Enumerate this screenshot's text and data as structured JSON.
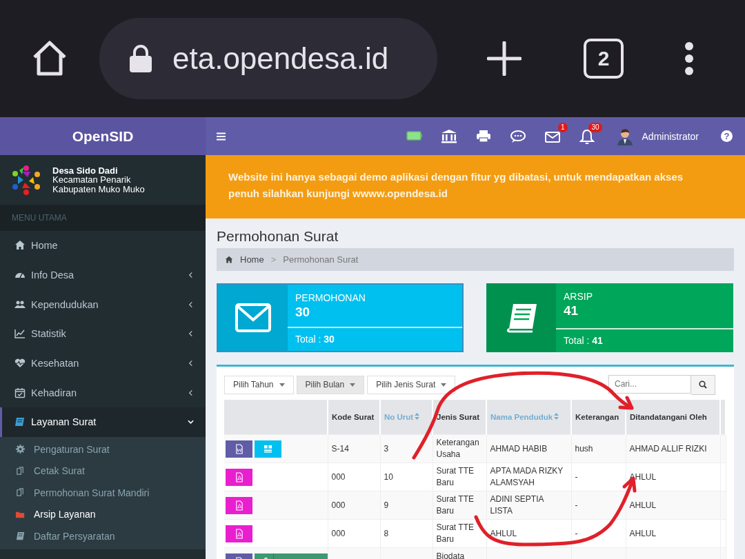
{
  "browser": {
    "url": "eta.opendesa.id",
    "tab_count": "2"
  },
  "header": {
    "brand": "OpenSID",
    "mail_badge": "1",
    "bell_badge": "30",
    "user": "Administrator",
    "help": "?"
  },
  "village": {
    "name": "Desa Sido Dadi",
    "district": "Kecamatan Penarik",
    "regency": "Kabupaten Muko Muko"
  },
  "menu_header": "MENU UTAMA",
  "menu": [
    {
      "label": "Home",
      "selected": false
    },
    {
      "label": "Info Desa",
      "expanded": false,
      "selected": false
    },
    {
      "label": "Kependudukan",
      "expanded": false,
      "selected": false
    },
    {
      "label": "Statistik",
      "expanded": false,
      "selected": false
    },
    {
      "label": "Kesehatan",
      "expanded": false,
      "selected": false
    },
    {
      "label": "Kehadiran",
      "expanded": false,
      "selected": false
    },
    {
      "label": "Layanan Surat",
      "expanded": true,
      "selected": true,
      "children": [
        {
          "label": "Pengaturan Surat",
          "selected": false
        },
        {
          "label": "Cetak Surat",
          "selected": false
        },
        {
          "label": "Permohonan Surat Mandiri",
          "selected": false
        },
        {
          "label": "Arsip Layanan",
          "selected": true
        },
        {
          "label": "Daftar Persyaratan",
          "selected": false
        }
      ]
    }
  ],
  "alert": "Website ini hanya sebagai demo aplikasi dengan fitur yg dibatasi, untuk mendapatkan akses penuh silahkan kunjungi wwww.opendesa.id",
  "page_title": "Permohonan Surat",
  "breadcrumb": {
    "items": [
      "Home",
      "Permohonan Surat"
    ],
    "separator": ">"
  },
  "cards": [
    {
      "label": "PERMOHONAN",
      "value": "30",
      "total": "Total : **30**",
      "color": "#00c0ef",
      "selected": true
    },
    {
      "label": "ARSIP",
      "value": "41",
      "total": "Total : **41**",
      "color": "#00a65a",
      "selected": false
    }
  ],
  "filters": [
    {
      "label": "Pilih Tahun",
      "focused": false
    },
    {
      "label": "Pilih Bulan",
      "focused": true
    },
    {
      "label": "Pilih Jenis Surat",
      "focused": false
    }
  ],
  "search": {
    "placeholder": "Cari..."
  },
  "table": {
    "columns": [
      {
        "label": "Kode Surat",
        "sortable": false
      },
      {
        "label": "No Urut",
        "sortable": true
      },
      {
        "label": "Jenis Surat",
        "sortable": false
      },
      {
        "label": "Nama Penduduk",
        "sortable": true
      },
      {
        "label": "Keterangan",
        "sortable": false
      },
      {
        "label": "Ditandatangani Oleh",
        "sortable": false
      }
    ],
    "rows": [
      {
        "actions": [
          {
            "kind": "word"
          },
          {
            "kind": "qr"
          }
        ],
        "cells": [
          "S-14",
          "3",
          "Keterangan Usaha",
          "AHMAD HABIB",
          "hush",
          "AHMAD ALLIF RIZKI"
        ]
      },
      {
        "actions": [
          {
            "kind": "pdf"
          }
        ],
        "cells": [
          "000",
          "10",
          "Surat TTE Baru",
          "APTA MADA RIZKY ALAMSYAH",
          "-",
          "AHLUL"
        ]
      },
      {
        "actions": [
          {
            "kind": "pdf"
          }
        ],
        "cells": [
          "000",
          "9",
          "Surat TTE Baru",
          "ADINI SEPTIA LISTA",
          "-",
          "AHLUL"
        ]
      },
      {
        "actions": [
          {
            "kind": "pdf"
          }
        ],
        "cells": [
          "000",
          "8",
          "Surat TTE Baru",
          "AHLUL",
          "-",
          "AHLUL"
        ]
      },
      {
        "actions": [
          {
            "kind": "word"
          },
          {
            "kind": "attach"
          }
        ],
        "cells": [
          null,
          null,
          "Biodata",
          null,
          null,
          null
        ]
      }
    ]
  }
}
